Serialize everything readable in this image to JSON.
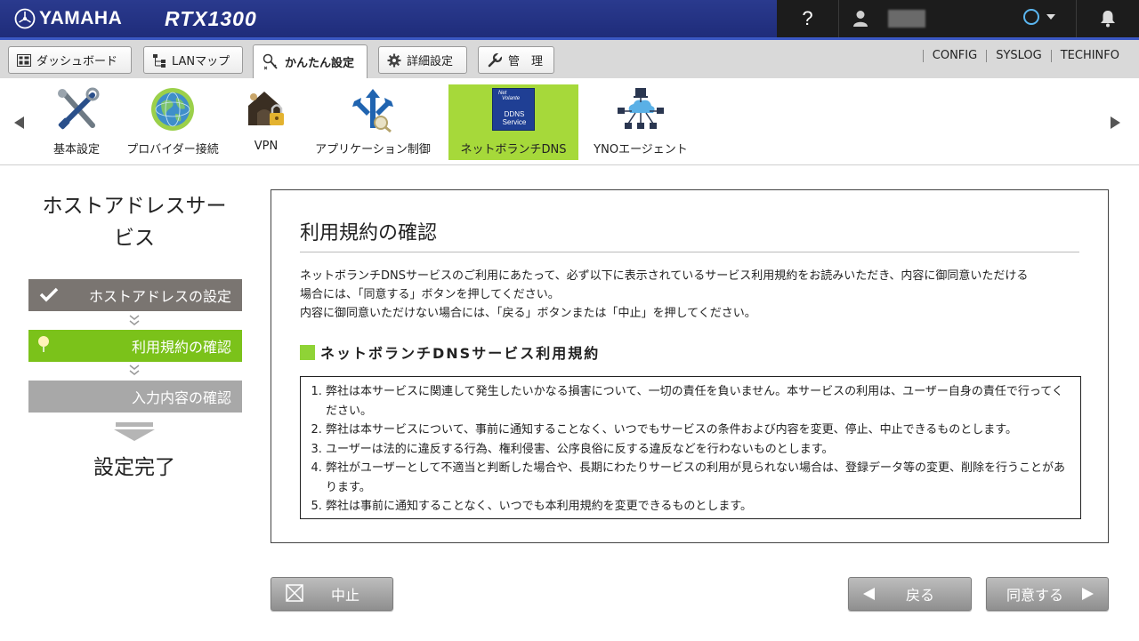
{
  "header": {
    "brand": "YAMAHA",
    "model": "RTX1300",
    "help_label": "?"
  },
  "nav": {
    "tabs": [
      {
        "label": "ダッシュボード"
      },
      {
        "label": "LANマップ"
      },
      {
        "label": "かんたん設定"
      },
      {
        "label": "詳細設定"
      },
      {
        "label": "管　理"
      }
    ],
    "links": [
      "CONFIG",
      "SYSLOG",
      "TECHINFO"
    ]
  },
  "features": [
    {
      "label": "基本設定",
      "icon": "tools-icon"
    },
    {
      "label": "プロバイダー接続",
      "icon": "globe-icon"
    },
    {
      "label": "VPN",
      "icon": "lock-house-icon"
    },
    {
      "label": "アプリケーション制御",
      "icon": "app-control-icon"
    },
    {
      "label": "ネットボランチDNS",
      "icon": "ddns-icon",
      "icon_text": [
        "Net",
        "Volante",
        "DDNS",
        "Service"
      ]
    },
    {
      "label": "YNOエージェント",
      "icon": "network-icon"
    }
  ],
  "wizard": {
    "title_line1": "ホストアドレスサー",
    "title_line2": "ビス",
    "steps": [
      {
        "label": "ホストアドレスの設定"
      },
      {
        "label": "利用規約の確認"
      },
      {
        "label": "入力内容の確認"
      }
    ],
    "done_label": "設定完了"
  },
  "main": {
    "title": "利用規約の確認",
    "desc_line1": "ネットボランチDNSサービスのご利用にあたって、必ず以下に表示されているサービス利用規約をお読みいただき、内容に御同意いただける",
    "desc_line2": "場合には、「同意する」ボタンを押してください。",
    "desc_line3": "内容に御同意いただけない場合には、「戻る」ボタンまたは「中止」を押してください。",
    "terms_heading": "ネットボランチDNSサービス利用規約",
    "terms": [
      "弊社は本サービスに関連して発生したいかなる損害について、一切の責任を負いません。本サービスの利用は、ユーザー自身の責任で行ってください。",
      "弊社は本サービスについて、事前に通知することなく、いつでもサービスの条件および内容を変更、停止、中止できるものとします。",
      "ユーザーは法的に違反する行為、権利侵害、公序良俗に反する違反などを行わないものとします。",
      "弊社がユーザーとして不適当と判断した場合や、長期にわたりサービスの利用が見られない場合は、登録データ等の変更、削除を行うことがあります。",
      "弊社は事前に通知することなく、いつでも本利用規約を変更できるものとします。"
    ]
  },
  "buttons": {
    "cancel": "中止",
    "back": "戻る",
    "agree": "同意する"
  },
  "colors": {
    "header_bg": "#1f2c7a",
    "selected_feature": "#a6d93a",
    "active_step": "#7bc21a",
    "done_step": "#7a7571",
    "pending_step": "#a8a8a8"
  }
}
